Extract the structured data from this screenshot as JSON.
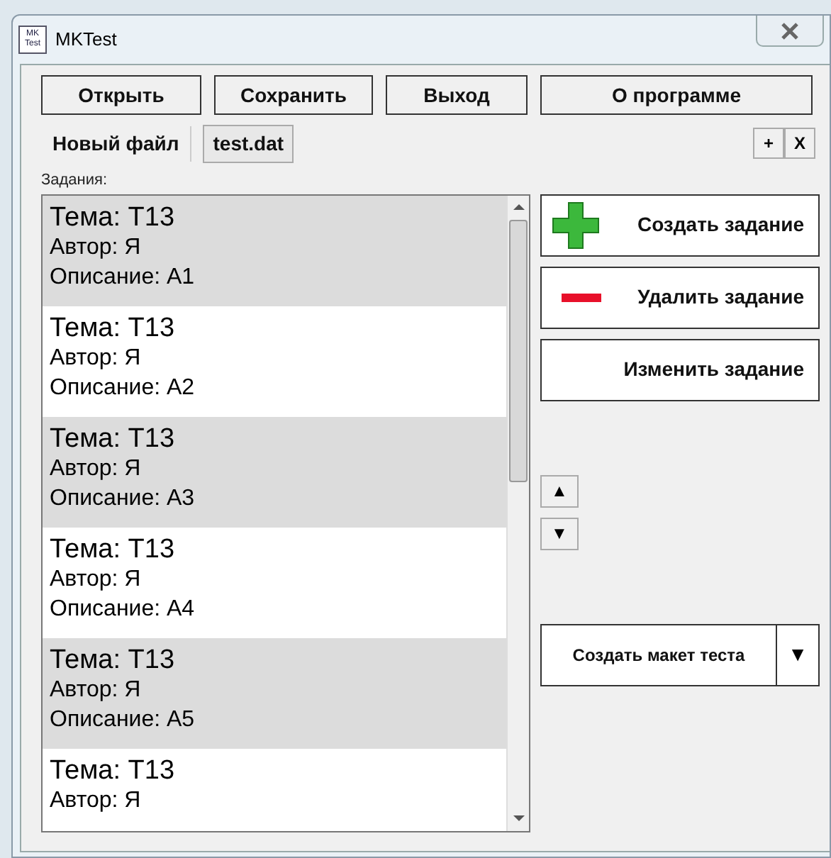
{
  "window": {
    "title": "MKTest",
    "icon_text": "MK Test"
  },
  "toolbar": [
    "Открыть",
    "Сохранить",
    "Выход",
    "О программе"
  ],
  "tabs": [
    {
      "label": "Новый файл",
      "selected": false
    },
    {
      "label": "test.dat",
      "selected": true
    }
  ],
  "tab_buttons": [
    "+",
    "X"
  ],
  "tasks_label": "Задания:",
  "tasks": [
    {
      "topic": "Тема: T13",
      "author": "Автор: Я",
      "description": "Описание: A1"
    },
    {
      "topic": "Тема: T13",
      "author": "Автор: Я",
      "description": "Описание: A2"
    },
    {
      "topic": "Тема: T13",
      "author": "Автор: Я",
      "description": "Описание: A3"
    },
    {
      "topic": "Тема: T13",
      "author": "Автор: Я",
      "description": "Описание: A4"
    },
    {
      "topic": "Тема: T13",
      "author": "Автор: Я",
      "description": "Описание: A5"
    },
    {
      "topic": "Тема: T13",
      "author": "Автор: Я"
    }
  ],
  "actions": [
    {
      "kind": "add",
      "label": "Создать задание"
    },
    {
      "kind": "remove",
      "label": "Удалить задание"
    },
    {
      "kind": "edit",
      "label": "Изменить задание"
    }
  ],
  "move_buttons": [
    "▲",
    "▼"
  ],
  "split_button": {
    "label": "Создать макет теста",
    "arrow": "▼"
  }
}
